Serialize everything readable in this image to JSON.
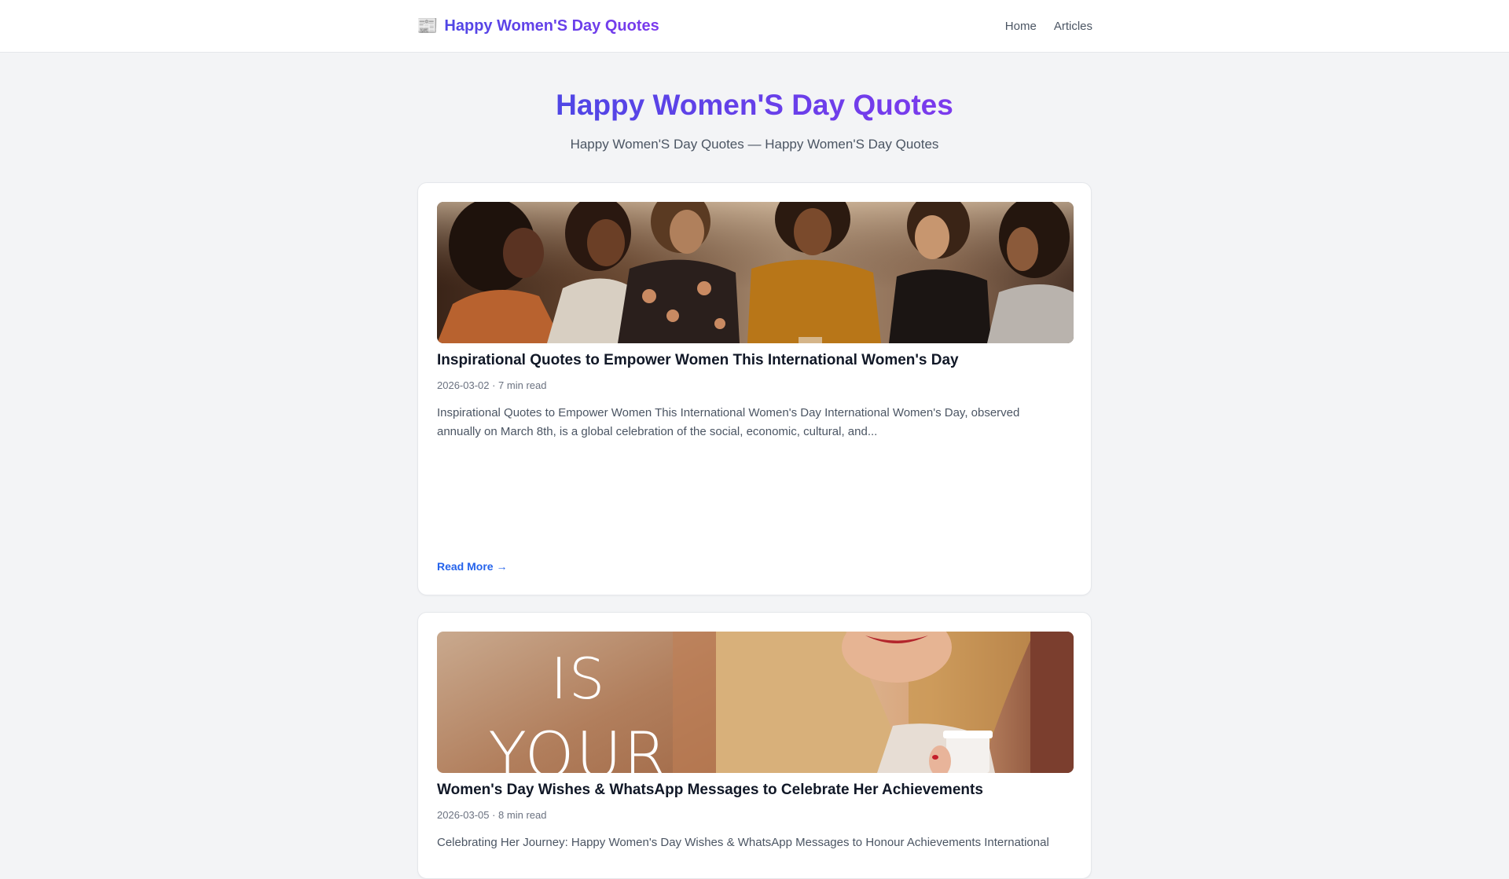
{
  "header": {
    "brand_icon": "newspaper-icon",
    "brand_emoji": "📰",
    "brand_title": "Happy Women'S Day Quotes",
    "nav": [
      {
        "label": "Home"
      },
      {
        "label": "Articles"
      }
    ]
  },
  "hero": {
    "title": "Happy Women'S Day Quotes",
    "subtitle": "Happy Women'S Day Quotes — Happy Women'S Day Quotes"
  },
  "articles": [
    {
      "title": "Inspirational Quotes to Empower Women This International Women's Day",
      "meta": "2026-03-02 · 7 min read",
      "excerpt": "Inspirational Quotes to Empower Women This International Women's Day International Women's Day, observed annually on March 8th, is a global celebration of the social, economic, cultural, and...",
      "read_more": "Read More →"
    },
    {
      "title": "Women's Day Wishes & WhatsApp Messages to Celebrate Her Achievements",
      "meta": "2026-03-05 · 8 min read",
      "excerpt": "Celebrating Her Journey: Happy Women's Day Wishes & WhatsApp Messages to Honour Achievements International",
      "image_text": "IS YOUR"
    }
  ],
  "colors": {
    "accent": "#4f46e5",
    "accent_2": "#7c3aed",
    "link": "#2563eb",
    "page_bg": "#f3f4f6"
  }
}
